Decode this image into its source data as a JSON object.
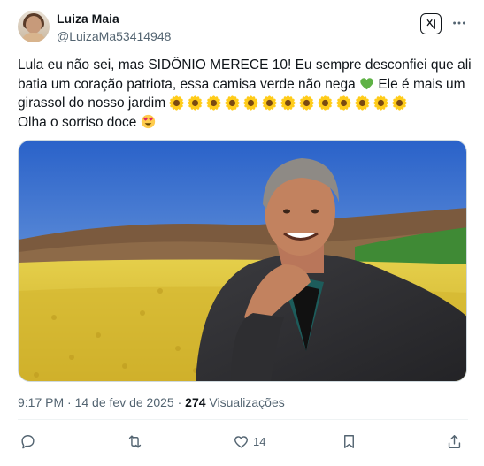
{
  "author": {
    "display_name": "Luiza Maia",
    "handle": "@LuizaMa53414948"
  },
  "header_icons": {
    "grok": "grok-icon",
    "more": "more-icon"
  },
  "tweet": {
    "line1": "Lula eu não sei, mas SIDÔNIO MERECE 10! Eu sempre desconfiei que ali",
    "line2a": "batia um coração patriota, essa camisa verde não nega",
    "line2b": " Ele é mais um",
    "line3": "girassol do nosso jardim",
    "sunflower_count": 13,
    "line4": "Olha o sorriso doce"
  },
  "meta": {
    "time": "9:17 PM",
    "separator": " · ",
    "date": "14 de fev de 2025",
    "views_count": "274",
    "views_label": "Visualizações"
  },
  "actions": {
    "reply_icon": "reply-icon",
    "retweet_icon": "retweet-icon",
    "like_icon": "heart-icon",
    "like_count": "14",
    "bookmark_icon": "bookmark-icon",
    "share_icon": "share-icon"
  },
  "colors": {
    "text": "#0f1419",
    "secondary": "#536471",
    "divider": "#eff3f4"
  }
}
